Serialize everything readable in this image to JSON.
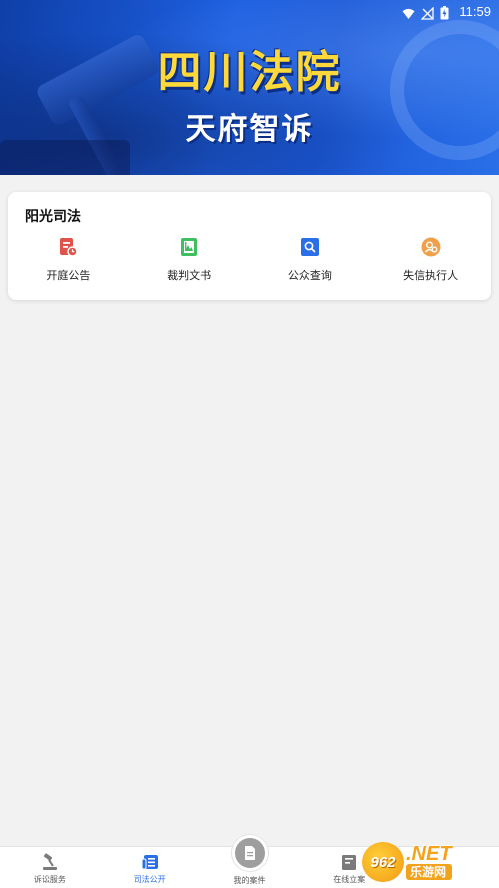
{
  "status_bar": {
    "time": "11:59"
  },
  "banner": {
    "title": "四川法院",
    "subtitle": "天府智诉"
  },
  "card": {
    "title": "阳光司法",
    "entries": [
      {
        "label": "开庭公告",
        "icon": "court-notice-icon",
        "color": "#e0534a"
      },
      {
        "label": "裁判文书",
        "icon": "judgment-document-icon",
        "color": "#3fbf5f"
      },
      {
        "label": "公众查询",
        "icon": "public-search-icon",
        "color": "#2a6fe8"
      },
      {
        "label": "失信执行人",
        "icon": "dishonest-debtor-icon",
        "color": "#f0a04b"
      }
    ]
  },
  "tabbar": {
    "tabs": [
      {
        "label": "诉讼服务",
        "icon": "gavel-icon"
      },
      {
        "label": "司法公开",
        "icon": "newspaper-icon",
        "active": true
      },
      {
        "label": "我的案件",
        "icon": "case-document-icon"
      },
      {
        "label": "在线立案",
        "icon": "filing-icon"
      }
    ]
  },
  "watermark": {
    "logo": "962",
    "net": ".NET",
    "site_name": "乐游网"
  },
  "colors": {
    "accent": "#2a6fe8",
    "banner_title": "#ffd83a",
    "background": "#f2f2f2"
  }
}
